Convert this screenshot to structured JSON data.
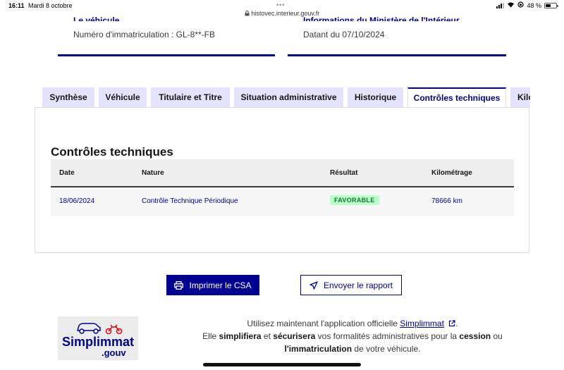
{
  "statusbar": {
    "time": "16:11",
    "date": "Mardi 8 octobre",
    "url": "histovec.interieur.gouv.fr",
    "battery": "48 %",
    "battery_level": 0.48
  },
  "cards": {
    "vehicle": {
      "title": "Le véhicule",
      "line": "Numéro d'immatriculation : GL-8**-FB"
    },
    "ministry": {
      "title": "Informations du Ministère de l'Intérieur",
      "line": "Datant du 07/10/2024"
    }
  },
  "tabs": [
    "Synthèse",
    "Véhicule",
    "Titulaire et Titre",
    "Situation administrative",
    "Historique",
    "Contrôles techniques",
    "Kilométrage"
  ],
  "section": {
    "title": "Contrôles techniques",
    "columns": [
      "Date",
      "Nature",
      "Résultat",
      "Kilométrage"
    ],
    "rows": [
      {
        "date": "18/06/2024",
        "nature": "Contrôle Technique Périodique",
        "result": "FAVORABLE",
        "km": "78666 km"
      }
    ]
  },
  "actions": {
    "print": "Imprimer le CSA",
    "send": "Envoyer le rapport"
  },
  "promo": {
    "logo_word": "Simplimmat",
    "logo_gouv": ".gouv",
    "line1_prefix": "Utilisez maintenant l'application officielle",
    "link": "Simplimmat",
    "line1_suffix": ".",
    "line2_a": "Elle",
    "line2_b": "simplifiera",
    "line2_c": "et",
    "line2_d": "sécurisera",
    "line2_e": "vos formalités administratives pour la",
    "line2_f": "cession",
    "line2_g": "ou",
    "line3_a": "l'immatriculation",
    "line3_b": "de votre véhicule."
  },
  "colors": {
    "brand": "#000091",
    "success_bg": "#b8fec9",
    "success_text": "#18753c"
  }
}
